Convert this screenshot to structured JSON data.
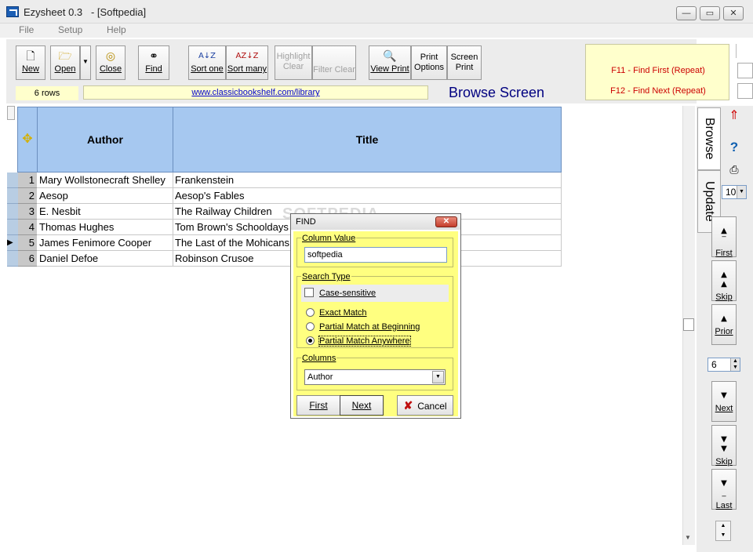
{
  "window": {
    "title": "Ezysheet 0.3   - [Softpedia]",
    "controls": {
      "minimize": "—",
      "restore": "▭",
      "close": "✕"
    }
  },
  "menu": [
    "File",
    "Setup",
    "Help"
  ],
  "toolbar": {
    "new": "New",
    "open": "Open",
    "close": "Close",
    "find": "Find",
    "sort_one": "Sort one",
    "sort_many": "Sort many",
    "highlight_clear": [
      "Highlight",
      "Clear"
    ],
    "filter_clear": "Filter Clear",
    "view_print": "View Print",
    "print_options": [
      "Print",
      "Options"
    ],
    "screen_print": [
      "Screen",
      "Print"
    ]
  },
  "status": {
    "row_count": "6 rows",
    "url": "www.classicbookshelf.com/library",
    "screen_title": "Browse Screen"
  },
  "function_keys": {
    "f11": "F11 - Find First (Repeat)",
    "f12": "F12 - Find Next (Repeat)"
  },
  "grid": {
    "columns": [
      "Author",
      "Title"
    ],
    "current_row": 5,
    "rows": [
      {
        "n": "1",
        "author": "Mary Wollstonecraft Shelley",
        "title": "Frankenstein"
      },
      {
        "n": "2",
        "author": "Aesop",
        "title": "Aesop's Fables"
      },
      {
        "n": "3",
        "author": "E. Nesbit",
        "title": "The Railway Children"
      },
      {
        "n": "4",
        "author": "Thomas Hughes",
        "title": "Tom Brown's Schooldays"
      },
      {
        "n": "5",
        "author": "James Fenimore Cooper",
        "title": "The Last of the Mohicans"
      },
      {
        "n": "6",
        "author": "Daniel Defoe",
        "title": "Robinson Crusoe"
      }
    ]
  },
  "right_panel": {
    "tabs": [
      "Browse",
      "Update"
    ],
    "page_size": "10",
    "skip_value": "6",
    "nav": {
      "first": "First",
      "skip_up": "Skip",
      "prior": "Prior",
      "next": "Next",
      "skip_down": "Skip",
      "last": "Last"
    }
  },
  "find_dialog": {
    "title": "FIND",
    "column_value_label": "Column Value",
    "column_value": "softpedia",
    "search_type_label": "Search Type",
    "case_sensitive": "Case-sensitive",
    "options": [
      "Exact Match",
      "Partial Match at Beginning",
      "Partial Match Anywhere"
    ],
    "selected_option": "Partial Match Anywhere",
    "columns_label": "Columns",
    "column_selected": "Author",
    "buttons": {
      "first": "First",
      "next": "Next",
      "cancel": "Cancel"
    }
  },
  "watermark": "SOFTPEDIA",
  "colors": {
    "header_blue": "#a6c8f0",
    "dialog_yellow": "#ffff80",
    "fkey_red": "#cc0000",
    "title_navy": "#000080"
  }
}
